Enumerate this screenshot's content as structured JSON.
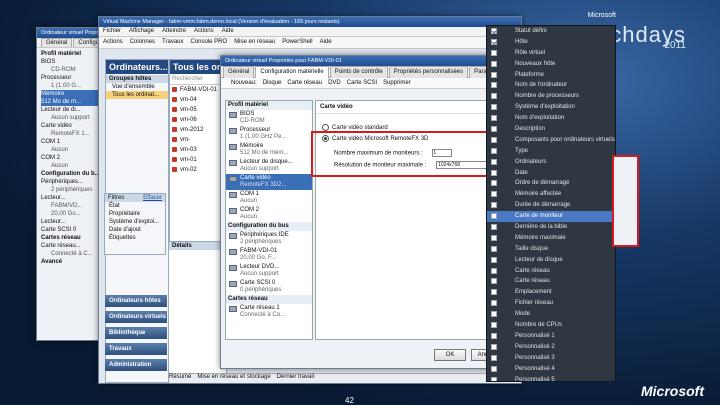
{
  "branding": {
    "company": "Microsoft",
    "event": "techdays",
    "year": "2011",
    "logo": "Microsoft"
  },
  "slide_number": "42",
  "win1": {
    "title": "Ordinateur virtuel Propriétés",
    "tabs": [
      "Général",
      "Configuration"
    ],
    "tree": [
      {
        "t": "Profil matériel",
        "h": true
      },
      {
        "t": "BIOS"
      },
      {
        "t": "CD-ROM",
        "sub": true
      },
      {
        "t": "Processeur"
      },
      {
        "t": "1 (1.00 G...",
        "sub": true
      },
      {
        "t": "Mémoire",
        "sel": true
      },
      {
        "t": "512 Mo de m...",
        "sel": true
      },
      {
        "t": "Lecteur de di..."
      },
      {
        "t": "Aucun support",
        "sub": true
      },
      {
        "t": "Carte vidéo"
      },
      {
        "t": "RemoteFX 1...",
        "sub": true
      },
      {
        "t": "COM 1"
      },
      {
        "t": "Aucun",
        "sub": true
      },
      {
        "t": "COM 2"
      },
      {
        "t": "Aucun",
        "sub": true
      },
      {
        "t": "Configuration du b...",
        "h": true
      },
      {
        "t": "Périphériques..."
      },
      {
        "t": "2 périphériques",
        "sub": true
      },
      {
        "t": "Lecteur..."
      },
      {
        "t": "FABM/VD...",
        "sub": true
      },
      {
        "t": "20,00 Go...",
        "sub": true
      },
      {
        "t": "Lecteur..."
      },
      {
        "t": "Carte SCSI 0"
      },
      {
        "t": "Cartes réseau",
        "h": true
      },
      {
        "t": "Carte réseau..."
      },
      {
        "t": "Connecté à C...",
        "sub": true
      },
      {
        "t": "Avancé",
        "h": true
      }
    ]
  },
  "win2": {
    "title": "Virtual Machine Manager - fabm-vmm.fabm.demo.local (Version d'évaluation - 165 jours restants)",
    "menu": [
      "Fichier",
      "Affichage",
      "Atteindre",
      "Actions",
      "Aide"
    ],
    "toolbar": [
      "Actions",
      "Colonnes",
      "Travaux",
      "Console PRO",
      "Mise en réseau",
      "PowerShell",
      "Aide"
    ],
    "nav_title": "Ordinateurs...",
    "nav_groups_label": "Groupes hôtes",
    "nav_items": [
      {
        "t": "Vue d'ensemble"
      },
      {
        "t": "Tous les ordinat...",
        "sel": true
      }
    ],
    "filters_label": "Filtres",
    "filters_clear": "Effacer",
    "filter_items": [
      "État",
      "Propriétaire",
      "Système d'exploi...",
      "Date d'ajout",
      "Étiquettes"
    ],
    "bottom_buttons": [
      "Ordinateurs hôtes",
      "Ordinateurs virtuels",
      "Bibliothèque",
      "Travaux",
      "Administration"
    ],
    "center_title": "Tous les ord",
    "search_placeholder": "Rechercher",
    "vms": [
      "FABM-VDI-01",
      "vm-04",
      "vm-05",
      "vm-06",
      "vm-2012",
      "vm-",
      "vm-03",
      "vm-01",
      "vm-02"
    ],
    "details_label": "Détails",
    "bottom_tabs": [
      "Résumé",
      "Mise en réseau et stockage",
      "Dernier travail"
    ]
  },
  "win3": {
    "title": "Ordinateur virtuel Propriétés pour FABM-VDI-01",
    "tabs": [
      "Général",
      "Configuration matérielle",
      "Points de contrôle",
      "Propriétés personnalisées",
      "Paramètres",
      "Actions"
    ],
    "toolbar": [
      "Nouveau:",
      "Disque",
      "Carte réseau",
      "DVD",
      "Carte SCSI",
      "Supprimer"
    ],
    "hw": [
      {
        "t": "Profil matériel",
        "h": true
      },
      {
        "t": "BIOS",
        "s": "CD-ROM"
      },
      {
        "t": "Processeur",
        "s": "1 (1.00 GHz Pe..."
      },
      {
        "t": "Mémoire",
        "s": "512 Mo de mém..."
      },
      {
        "t": "Lecteur de disque...",
        "s": "Aucun support"
      },
      {
        "t": "Carte vidéo",
        "s": "RemoteFX 3D2...",
        "sel": true
      },
      {
        "t": "COM 1",
        "s": "Aucun"
      },
      {
        "t": "COM 2",
        "s": "Aucun"
      },
      {
        "t": "Configuration du bus",
        "h": true
      },
      {
        "t": "Périphériques IDE",
        "s": "2 périphériques"
      },
      {
        "t": "FABM-VDI-01",
        "s": "20,00 Go, F..."
      },
      {
        "t": "Lecteur DVD...",
        "s": "Aucun support"
      },
      {
        "t": "Carte SCSI 0",
        "s": "0 périphériques"
      },
      {
        "t": "Cartes réseau",
        "h": true
      },
      {
        "t": "Carte réseau 1",
        "s": "Connecté à Co..."
      }
    ],
    "pane_title": "Carte vidéo",
    "opt_standard": "Carte vidéo standard",
    "opt_remotefx": "Carte vidéo Microsoft RemoteFX 3D",
    "monitors_label": "Nombre maximum de moniteurs :",
    "monitors_value": "1",
    "resolution_label": "Résolution de moniteur maximale :",
    "resolution_value": "1024x768",
    "ok": "OK",
    "cancel": "Annuler"
  },
  "dropdown": {
    "items": [
      {
        "t": "Statut défini",
        "on": true
      },
      {
        "t": "Hôte",
        "on": true
      },
      {
        "t": "Rôle virtuel"
      },
      {
        "t": "Nouveaux hôte"
      },
      {
        "t": "Plateforme"
      },
      {
        "t": "Nom de l'ordinateur"
      },
      {
        "t": "Nombre de processeurs"
      },
      {
        "t": "Système d'exploitation"
      },
      {
        "t": "Nom d'exploitation"
      },
      {
        "t": "Description"
      },
      {
        "t": "Composants pour ordinateurs virtuels"
      },
      {
        "t": "Type"
      },
      {
        "t": "Ordinateurs"
      },
      {
        "t": "Date"
      },
      {
        "t": "Ordre de démarrage"
      },
      {
        "t": "Mémoire affectée"
      },
      {
        "t": "Durée de démarrage"
      },
      {
        "t": "Carte de moniteur",
        "hl": true
      },
      {
        "t": "Dernière de la bible"
      },
      {
        "t": "Mémoire maximale"
      },
      {
        "t": "Taille disque"
      },
      {
        "t": "Lecteur de disque"
      },
      {
        "t": "Carte réseau"
      },
      {
        "t": "Carte réseau"
      },
      {
        "t": "Emplacement"
      },
      {
        "t": "Fichier réseau"
      },
      {
        "t": "Mode"
      },
      {
        "t": "Nombre de CPUs"
      },
      {
        "t": "Personnalisé 1"
      },
      {
        "t": "Personnalisé 2"
      },
      {
        "t": "Personnalisé 3"
      },
      {
        "t": "Personnalisé 4"
      },
      {
        "t": "Personnalisé 5"
      }
    ]
  }
}
